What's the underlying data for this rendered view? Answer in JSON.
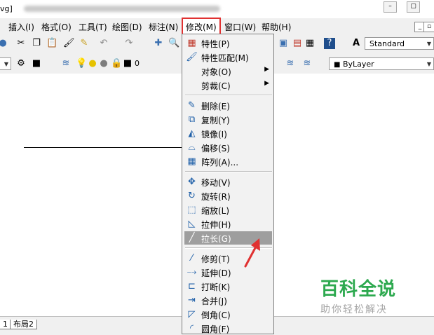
{
  "title": {
    "text": "vg]",
    "min_icon": "–",
    "max_icon": "▢"
  },
  "menubar": {
    "items": [
      "插入(I)",
      "格式(O)",
      "工具(T)",
      "绘图(D)",
      "标注(N)",
      "修改(M)",
      "窗口(W)",
      "帮助(H)"
    ],
    "active": "修改(M)"
  },
  "toolbar": {
    "text_style": "Standard",
    "layer_value": "0",
    "color_value": "ByLayer"
  },
  "dropdown": {
    "items": [
      {
        "label": "特性(P)",
        "icon": "properties-icon",
        "glyph": "▦"
      },
      {
        "label": "特性匹配(M)",
        "icon": "match-properties-brush-icon",
        "glyph": "🖌"
      },
      {
        "label": "对象(O)",
        "submenu": true
      },
      {
        "label": "剪裁(C)",
        "submenu": true
      },
      {
        "label": "删除(E)",
        "icon": "erase-icon",
        "glyph": "✎"
      },
      {
        "label": "复制(Y)",
        "icon": "copy-icon",
        "glyph": "⧉"
      },
      {
        "label": "镜像(I)",
        "icon": "mirror-icon",
        "glyph": "◭"
      },
      {
        "label": "偏移(S)",
        "icon": "offset-icon",
        "glyph": "⌓"
      },
      {
        "label": "阵列(A)...",
        "icon": "array-icon",
        "glyph": "▦"
      },
      {
        "label": "移动(V)",
        "icon": "move-icon",
        "glyph": "✥"
      },
      {
        "label": "旋转(R)",
        "icon": "rotate-icon",
        "glyph": "↻"
      },
      {
        "label": "缩放(L)",
        "icon": "scale-icon",
        "glyph": "⬚"
      },
      {
        "label": "拉伸(H)",
        "icon": "stretch-icon",
        "glyph": "◺"
      },
      {
        "label": "拉长(G)",
        "icon": "lengthen-icon",
        "glyph": "╱",
        "highlighted": true
      },
      {
        "label": "修剪(T)",
        "icon": "trim-icon",
        "glyph": "⁄"
      },
      {
        "label": "延伸(D)",
        "icon": "extend-icon",
        "glyph": "⤍"
      },
      {
        "label": "打断(K)",
        "icon": "break-icon",
        "glyph": "⊏"
      },
      {
        "label": "合并(J)",
        "icon": "join-icon",
        "glyph": "⇥"
      },
      {
        "label": "倒角(C)",
        "icon": "chamfer-icon",
        "glyph": "◸"
      },
      {
        "label": "圆角(F)",
        "icon": "fillet-icon",
        "glyph": "◜"
      }
    ]
  },
  "tabs": {
    "layout1": "1",
    "layout2": "布局2"
  },
  "watermark": {
    "title": "百科全说",
    "subtitle": "助你轻松解决"
  },
  "colors": {
    "highlight": "#9e9e9e",
    "accent_red": "#e03131",
    "watermark_green": "#2da94f"
  }
}
